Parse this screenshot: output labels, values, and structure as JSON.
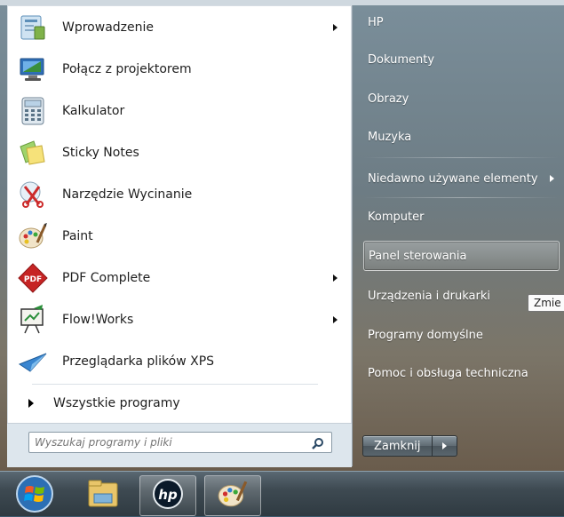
{
  "start_menu": {
    "programs": [
      {
        "label": "Wprowadzenie",
        "icon": "getting-started-icon",
        "has_submenu": true
      },
      {
        "label": "Połącz z projektorem",
        "icon": "projector-icon",
        "has_submenu": false
      },
      {
        "label": "Kalkulator",
        "icon": "calculator-icon",
        "has_submenu": false
      },
      {
        "label": "Sticky Notes",
        "icon": "sticky-notes-icon",
        "has_submenu": false
      },
      {
        "label": "Narzędzie Wycinanie",
        "icon": "snipping-tool-icon",
        "has_submenu": false
      },
      {
        "label": "Paint",
        "icon": "paint-icon",
        "has_submenu": false
      },
      {
        "label": "PDF Complete",
        "icon": "pdf-complete-icon",
        "has_submenu": true
      },
      {
        "label": "Flow!Works",
        "icon": "flowworks-icon",
        "has_submenu": true
      },
      {
        "label": "Przeglądarka plików XPS",
        "icon": "xps-viewer-icon",
        "has_submenu": false
      }
    ],
    "all_programs_label": "Wszystkie programy",
    "search": {
      "placeholder": "Wyszukaj programy i pliki",
      "value": ""
    },
    "right_items": [
      {
        "label": "HP"
      },
      {
        "label": "Dokumenty"
      },
      {
        "label": "Obrazy"
      },
      {
        "label": "Muzyka"
      },
      {
        "label": "Niedawno używane elementy",
        "has_submenu": true
      },
      {
        "label": "Komputer"
      },
      {
        "label": "Panel sterowania",
        "highlighted": true
      },
      {
        "label": "Urządzenia i drukarki"
      },
      {
        "label": "Programy domyślne"
      },
      {
        "label": "Pomoc i obsługa techniczna"
      }
    ],
    "tooltip": "Zmie",
    "shutdown_label": "Zamknij"
  },
  "taskbar": {
    "items": [
      {
        "icon": "windows-start-orb-icon"
      },
      {
        "icon": "file-explorer-icon"
      },
      {
        "icon": "hp-logo-icon"
      },
      {
        "icon": "paint-icon"
      }
    ]
  },
  "colors": {
    "left_pane": "#ffffff",
    "text_dark": "#1e1e1e",
    "text_light": "#ffffff",
    "highlight_border": "#e6ecf0"
  }
}
